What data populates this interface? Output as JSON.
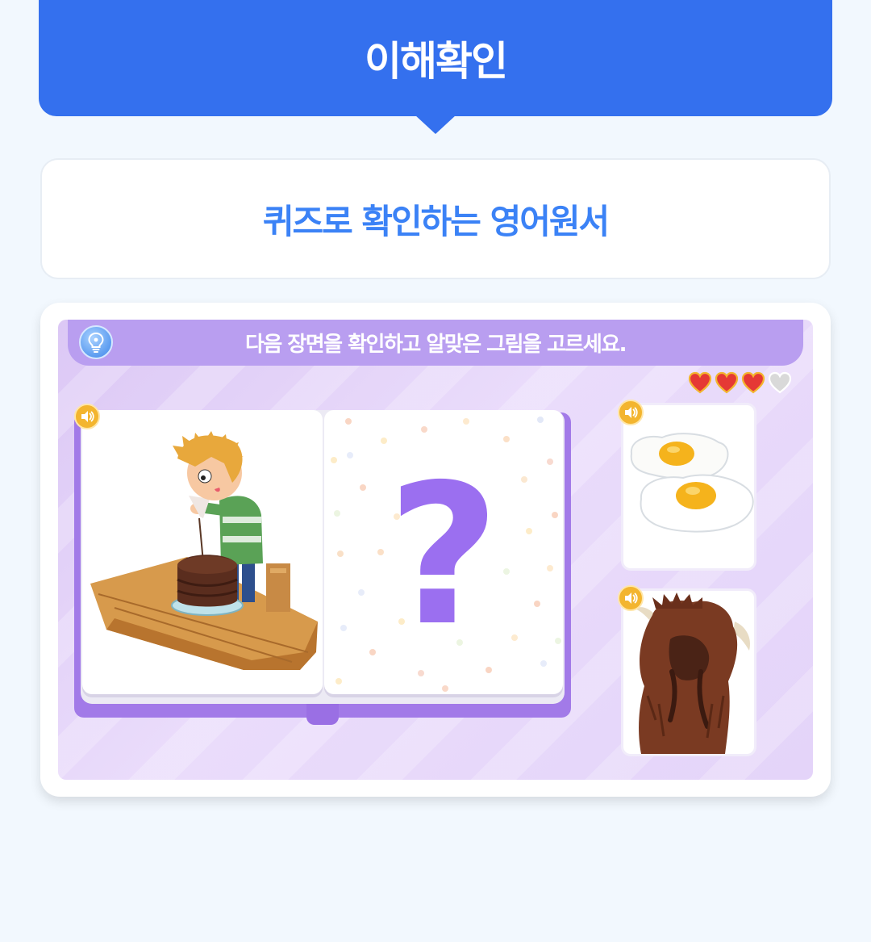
{
  "header": {
    "title": "이해확인"
  },
  "subtitle": {
    "text": "퀴즈로 확인하는 영어원서"
  },
  "quiz": {
    "instruction": "다음 장면을 확인하고 알맞은 그림을 고르세요.",
    "hint_icon": "lightbulb-icon",
    "sound_icon": "speaker-icon",
    "question_symbol": "?",
    "lives": {
      "filled": 3,
      "total": 4,
      "filled_color": "#e53935",
      "empty_color": "#d9d9d9"
    },
    "scene": {
      "image": "boy-decorating-chocolate-cake"
    },
    "options": [
      {
        "image": "fried-eggs"
      },
      {
        "image": "yak-covering-face"
      }
    ]
  },
  "colors": {
    "brand_blue": "#3470ee",
    "accent_purple": "#9b6ff0",
    "sound_orange": "#f3b52f"
  }
}
